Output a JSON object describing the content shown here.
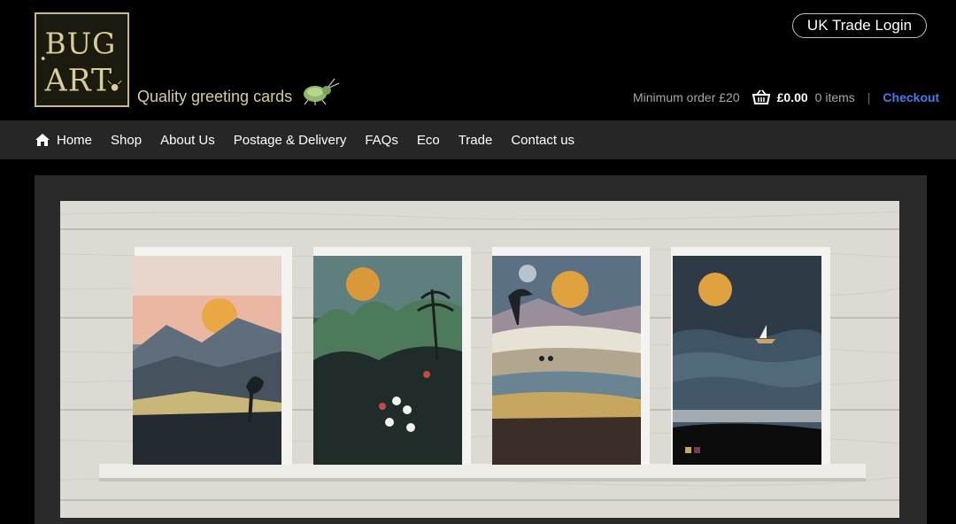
{
  "header": {
    "logo_alt": "BUG ART",
    "tagline": "Quality greeting cards",
    "trade_login": "UK Trade Login"
  },
  "cart": {
    "minimum_order": "Minimum order £20",
    "total": "£0.00",
    "items": "0 items",
    "separator": "|",
    "checkout": "Checkout",
    "icon": "basket-icon"
  },
  "nav": {
    "items": [
      {
        "label": "Home",
        "icon": "home-icon"
      },
      {
        "label": "Shop"
      },
      {
        "label": "About Us"
      },
      {
        "label": "Postage & Delivery"
      },
      {
        "label": "FAQs"
      },
      {
        "label": "Eco"
      },
      {
        "label": "Trade"
      },
      {
        "label": "Contact us"
      }
    ]
  },
  "colors": {
    "background": "#000000",
    "nav_background": "#262626",
    "tagline": "#d9cc9a",
    "logo_border": "#c8b98c",
    "checkout_link": "#4a7ae8",
    "muted_text": "#a6a6a6"
  },
  "banner": {
    "cards": [
      "sunset-mountains-card",
      "jungle-hummingbird-card",
      "cyclist-hills-card",
      "sailboat-sea-card"
    ]
  }
}
